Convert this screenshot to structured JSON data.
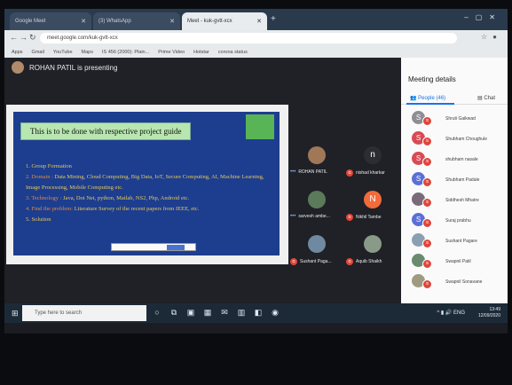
{
  "browser": {
    "tabs": [
      {
        "label": "Google Meet"
      },
      {
        "label": "(3) WhatsApp"
      },
      {
        "label": "Meet - kuk-gvtt-xcx",
        "active": true
      }
    ],
    "url": "meet.google.com/kuk-gvtt-xcx",
    "bookmarks": [
      "Apps",
      "Gmail",
      "YouTube",
      "Maps",
      "IS 456 (2000): Plain...",
      "Prime Video",
      "Hotstar",
      "corona status"
    ]
  },
  "meet": {
    "presenter_text": "ROHAN PATIL is presenting",
    "slide": {
      "title": "This is to be done with respective project guide",
      "items": [
        {
          "label": "",
          "text": "1. Group Formation"
        },
        {
          "label": "2. Domain : ",
          "text": "Data Mining, Cloud Computing, Big Data, IoT, Secure Computing, AI, Machine Learning, Image Processing, Mobile Computing etc."
        },
        {
          "label": "3. Technology : ",
          "text": "Java, Dot Net, python, Matlab, NS2, Php, Android etc."
        },
        {
          "label": "4. Find the problem: ",
          "text": "Literature Survey of the recent papers from IEEE, etc."
        },
        {
          "label": "",
          "text": "5. Solution"
        }
      ]
    },
    "tiles": [
      {
        "name": "ROHAN PATIL",
        "initial": "",
        "color": "#a07858",
        "muted": false
      },
      {
        "name": "nishad kharkar",
        "initial": "n",
        "color": "#2b2d31",
        "muted": true
      },
      {
        "name": "sarvesh ambe...",
        "initial": "",
        "color": "#5a7a5a",
        "muted": false
      },
      {
        "name": "Nikhil Tambe",
        "initial": "N",
        "color": "#f26b3a",
        "muted": true
      },
      {
        "name": "Sushant Paga...",
        "initial": "",
        "color": "#6f8aa0",
        "muted": true
      },
      {
        "name": "Aquib Shaikh",
        "initial": "",
        "color": "#8a9a88",
        "muted": true
      }
    ]
  },
  "panel": {
    "title": "Meeting details",
    "people_tab": "People (46)",
    "chat_tab": "Chat",
    "people": [
      {
        "name": "Shruti Gaikwad",
        "initial": "S",
        "color": "#8e8e93"
      },
      {
        "name": "Shubham Choughule",
        "initial": "S",
        "color": "#d94a54"
      },
      {
        "name": "shubham nasale",
        "initial": "S",
        "color": "#d94a54"
      },
      {
        "name": "Shubham Padale",
        "initial": "S",
        "color": "#5b6fd6"
      },
      {
        "name": "Siddhesh Mhatre",
        "initial": "",
        "color": "#7a6a7a"
      },
      {
        "name": "Suraj prabhu",
        "initial": "S",
        "color": "#5b6fd6"
      },
      {
        "name": "Sushant Pagare",
        "initial": "",
        "color": "#8aa0b0"
      },
      {
        "name": "Swapnil Patil",
        "initial": "",
        "color": "#6a8a70"
      },
      {
        "name": "Swapnil Sonavane",
        "initial": "",
        "color": "#a09a80"
      }
    ]
  },
  "taskbar": {
    "search_placeholder": "Type here to search",
    "lang": "ENG",
    "time": "13:49",
    "date": "12/09/2020"
  }
}
